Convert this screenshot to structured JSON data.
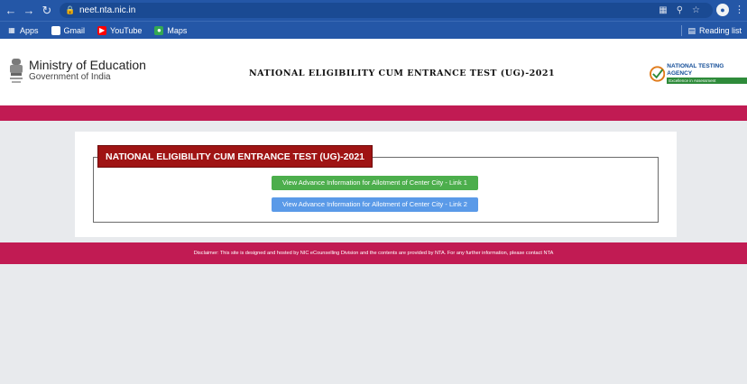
{
  "browser": {
    "url": "neet.nta.nic.in",
    "bookmarks": [
      "Apps",
      "Gmail",
      "YouTube",
      "Maps"
    ],
    "reading_list": "Reading list"
  },
  "header": {
    "ministry_title": "Ministry of Education",
    "ministry_sub": "Government of India",
    "exam_title": "NATIONAL ELIGIBILITY CUM ENTRANCE TEST (UG)-2021",
    "nta_name": "NATIONAL TESTING AGENCY",
    "nta_tagline": "Excellence in Assessment"
  },
  "main": {
    "legend": "NATIONAL ELIGIBILITY CUM ENTRANCE TEST (UG)-2021",
    "links": [
      {
        "label": "View Advance Information for Allotment of Center City - Link 1",
        "color": "#4cae4c"
      },
      {
        "label": "View Advance Information for Allotment of Center City - Link 2",
        "color": "#5a9ae8"
      }
    ]
  },
  "footer": {
    "disclaimer": "Disclaimer: This site is designed and hosted by NIC eCounselling Division and the contents are provided by NTA. For any further information, please contact NTA"
  },
  "colors": {
    "chrome_blue": "#2457a7",
    "maroon_strip": "#c11b53",
    "legend_red": "#9f1414"
  }
}
